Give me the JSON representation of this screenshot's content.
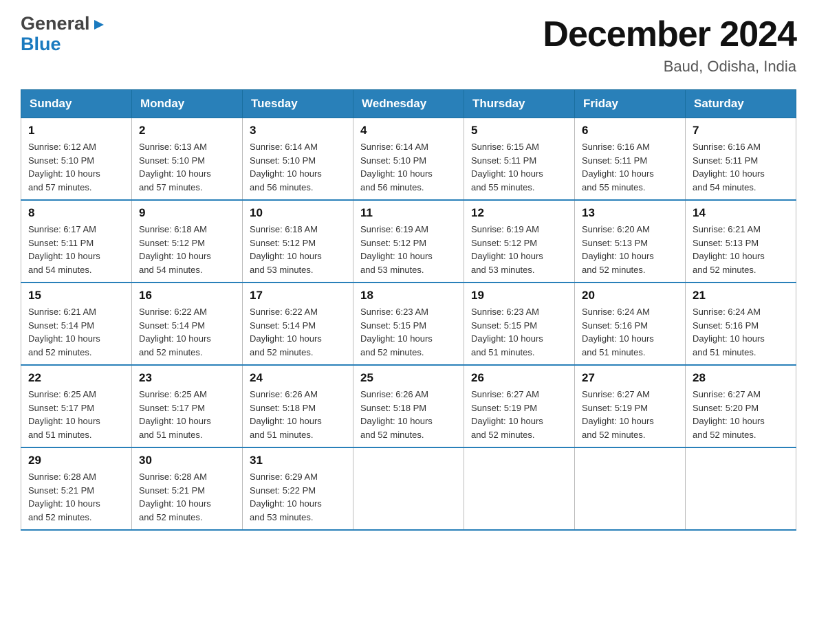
{
  "header": {
    "logo_general": "General",
    "logo_blue": "Blue",
    "title": "December 2024",
    "subtitle": "Baud, Odisha, India"
  },
  "days_of_week": [
    "Sunday",
    "Monday",
    "Tuesday",
    "Wednesday",
    "Thursday",
    "Friday",
    "Saturday"
  ],
  "weeks": [
    [
      {
        "day": 1,
        "sunrise": "6:12 AM",
        "sunset": "5:10 PM",
        "daylight": "10 hours and 57 minutes."
      },
      {
        "day": 2,
        "sunrise": "6:13 AM",
        "sunset": "5:10 PM",
        "daylight": "10 hours and 57 minutes."
      },
      {
        "day": 3,
        "sunrise": "6:14 AM",
        "sunset": "5:10 PM",
        "daylight": "10 hours and 56 minutes."
      },
      {
        "day": 4,
        "sunrise": "6:14 AM",
        "sunset": "5:10 PM",
        "daylight": "10 hours and 56 minutes."
      },
      {
        "day": 5,
        "sunrise": "6:15 AM",
        "sunset": "5:11 PM",
        "daylight": "10 hours and 55 minutes."
      },
      {
        "day": 6,
        "sunrise": "6:16 AM",
        "sunset": "5:11 PM",
        "daylight": "10 hours and 55 minutes."
      },
      {
        "day": 7,
        "sunrise": "6:16 AM",
        "sunset": "5:11 PM",
        "daylight": "10 hours and 54 minutes."
      }
    ],
    [
      {
        "day": 8,
        "sunrise": "6:17 AM",
        "sunset": "5:11 PM",
        "daylight": "10 hours and 54 minutes."
      },
      {
        "day": 9,
        "sunrise": "6:18 AM",
        "sunset": "5:12 PM",
        "daylight": "10 hours and 54 minutes."
      },
      {
        "day": 10,
        "sunrise": "6:18 AM",
        "sunset": "5:12 PM",
        "daylight": "10 hours and 53 minutes."
      },
      {
        "day": 11,
        "sunrise": "6:19 AM",
        "sunset": "5:12 PM",
        "daylight": "10 hours and 53 minutes."
      },
      {
        "day": 12,
        "sunrise": "6:19 AM",
        "sunset": "5:12 PM",
        "daylight": "10 hours and 53 minutes."
      },
      {
        "day": 13,
        "sunrise": "6:20 AM",
        "sunset": "5:13 PM",
        "daylight": "10 hours and 52 minutes."
      },
      {
        "day": 14,
        "sunrise": "6:21 AM",
        "sunset": "5:13 PM",
        "daylight": "10 hours and 52 minutes."
      }
    ],
    [
      {
        "day": 15,
        "sunrise": "6:21 AM",
        "sunset": "5:14 PM",
        "daylight": "10 hours and 52 minutes."
      },
      {
        "day": 16,
        "sunrise": "6:22 AM",
        "sunset": "5:14 PM",
        "daylight": "10 hours and 52 minutes."
      },
      {
        "day": 17,
        "sunrise": "6:22 AM",
        "sunset": "5:14 PM",
        "daylight": "10 hours and 52 minutes."
      },
      {
        "day": 18,
        "sunrise": "6:23 AM",
        "sunset": "5:15 PM",
        "daylight": "10 hours and 52 minutes."
      },
      {
        "day": 19,
        "sunrise": "6:23 AM",
        "sunset": "5:15 PM",
        "daylight": "10 hours and 51 minutes."
      },
      {
        "day": 20,
        "sunrise": "6:24 AM",
        "sunset": "5:16 PM",
        "daylight": "10 hours and 51 minutes."
      },
      {
        "day": 21,
        "sunrise": "6:24 AM",
        "sunset": "5:16 PM",
        "daylight": "10 hours and 51 minutes."
      }
    ],
    [
      {
        "day": 22,
        "sunrise": "6:25 AM",
        "sunset": "5:17 PM",
        "daylight": "10 hours and 51 minutes."
      },
      {
        "day": 23,
        "sunrise": "6:25 AM",
        "sunset": "5:17 PM",
        "daylight": "10 hours and 51 minutes."
      },
      {
        "day": 24,
        "sunrise": "6:26 AM",
        "sunset": "5:18 PM",
        "daylight": "10 hours and 51 minutes."
      },
      {
        "day": 25,
        "sunrise": "6:26 AM",
        "sunset": "5:18 PM",
        "daylight": "10 hours and 52 minutes."
      },
      {
        "day": 26,
        "sunrise": "6:27 AM",
        "sunset": "5:19 PM",
        "daylight": "10 hours and 52 minutes."
      },
      {
        "day": 27,
        "sunrise": "6:27 AM",
        "sunset": "5:19 PM",
        "daylight": "10 hours and 52 minutes."
      },
      {
        "day": 28,
        "sunrise": "6:27 AM",
        "sunset": "5:20 PM",
        "daylight": "10 hours and 52 minutes."
      }
    ],
    [
      {
        "day": 29,
        "sunrise": "6:28 AM",
        "sunset": "5:21 PM",
        "daylight": "10 hours and 52 minutes."
      },
      {
        "day": 30,
        "sunrise": "6:28 AM",
        "sunset": "5:21 PM",
        "daylight": "10 hours and 52 minutes."
      },
      {
        "day": 31,
        "sunrise": "6:29 AM",
        "sunset": "5:22 PM",
        "daylight": "10 hours and 53 minutes."
      },
      null,
      null,
      null,
      null
    ]
  ],
  "labels": {
    "sunrise": "Sunrise:",
    "sunset": "Sunset:",
    "daylight": "Daylight:"
  }
}
